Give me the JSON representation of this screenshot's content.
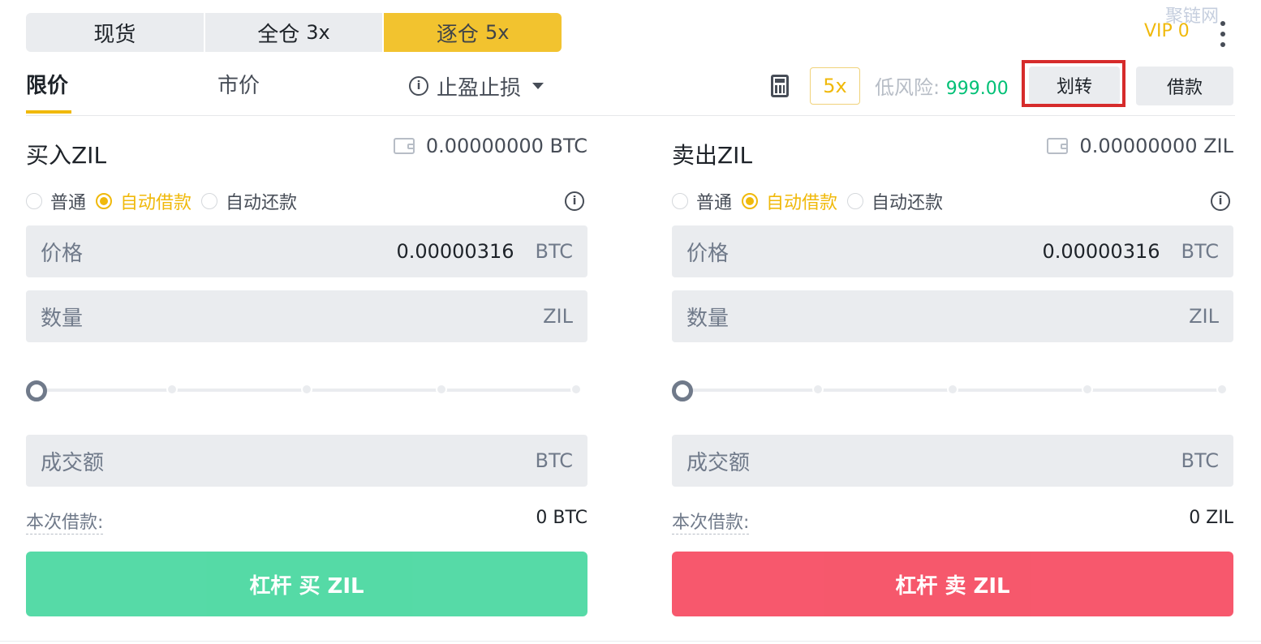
{
  "watermark": "聚链网",
  "mode_tabs": [
    {
      "label": "现货",
      "lev": ""
    },
    {
      "label": "全仓",
      "lev": "3x"
    },
    {
      "label": "逐仓",
      "lev": "5x"
    }
  ],
  "vip": "VIP 0",
  "order_tabs": {
    "limit": "限价",
    "market": "市价",
    "stop": "止盈止损"
  },
  "toolbar": {
    "leverage": "5x",
    "risk_label": "低风险:",
    "risk_value": "999.00",
    "transfer": "划转",
    "borrow": "借款"
  },
  "buy": {
    "title": "买入ZIL",
    "balance": "0.00000000 BTC",
    "radios": [
      "普通",
      "自动借款",
      "自动还款"
    ],
    "price_label": "价格",
    "price_value": "0.00000316",
    "price_unit": "BTC",
    "qty_label": "数量",
    "qty_unit": "ZIL",
    "total_label": "成交额",
    "total_unit": "BTC",
    "loan_label": "本次借款:",
    "loan_value": "0 BTC",
    "action": "杠杆 买 ZIL"
  },
  "sell": {
    "title": "卖出ZIL",
    "balance": "0.00000000 ZIL",
    "radios": [
      "普通",
      "自动借款",
      "自动还款"
    ],
    "price_label": "价格",
    "price_value": "0.00000316",
    "price_unit": "BTC",
    "qty_label": "数量",
    "qty_unit": "ZIL",
    "total_label": "成交额",
    "total_unit": "BTC",
    "loan_label": "本次借款:",
    "loan_value": "0 ZIL",
    "action": "杠杆 卖 ZIL"
  },
  "colors": {
    "accent": "#f0b90b",
    "buy": "#0ecb81",
    "sell": "#f6465d",
    "risk": "#02c076",
    "highlight": "#d62b2b"
  }
}
